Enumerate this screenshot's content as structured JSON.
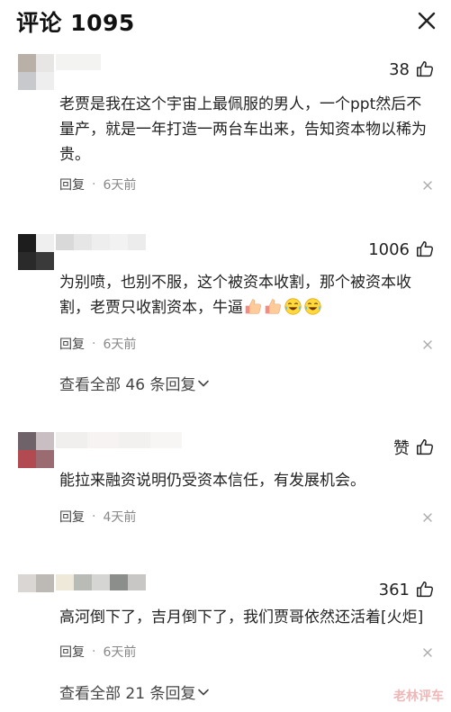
{
  "header": {
    "title": "评论 1095"
  },
  "comments": [
    {
      "likes": "38",
      "text": "老贾是我在这个宇宙上最佩服的男人，一个ppt然后不量产，就是一年打造一两台车出来，告知资本物以稀为贵。",
      "reply_label": "回复",
      "separator": "·",
      "time": "6天前"
    },
    {
      "likes": "1006",
      "text": "为别喷，也别不服，这个被资本收割，那个被资本收割，老贾只收割资本，牛逼",
      "emojis": [
        "thumbs-up-emoji",
        "thumbs-up-emoji",
        "laughing-crying-emoji",
        "laughing-crying-emoji"
      ],
      "reply_label": "回复",
      "separator": "·",
      "time": "6天前",
      "view_all": "查看全部 46 条回复"
    },
    {
      "likes": "赞",
      "text": "能拉来融资说明仍受资本信任，有发展机会。",
      "reply_label": "回复",
      "separator": "·",
      "time": "4天前"
    },
    {
      "likes": "361",
      "text": "高河倒下了，吉月倒下了，我们贾哥依然还活着[火炬]",
      "reply_label": "回复",
      "separator": "·",
      "time": "6天前",
      "view_all": "查看全部 21 条回复"
    }
  ],
  "watermark": "老林评车",
  "colors": {
    "text": "#222222",
    "meta": "#888888",
    "background": "#ffffff"
  }
}
